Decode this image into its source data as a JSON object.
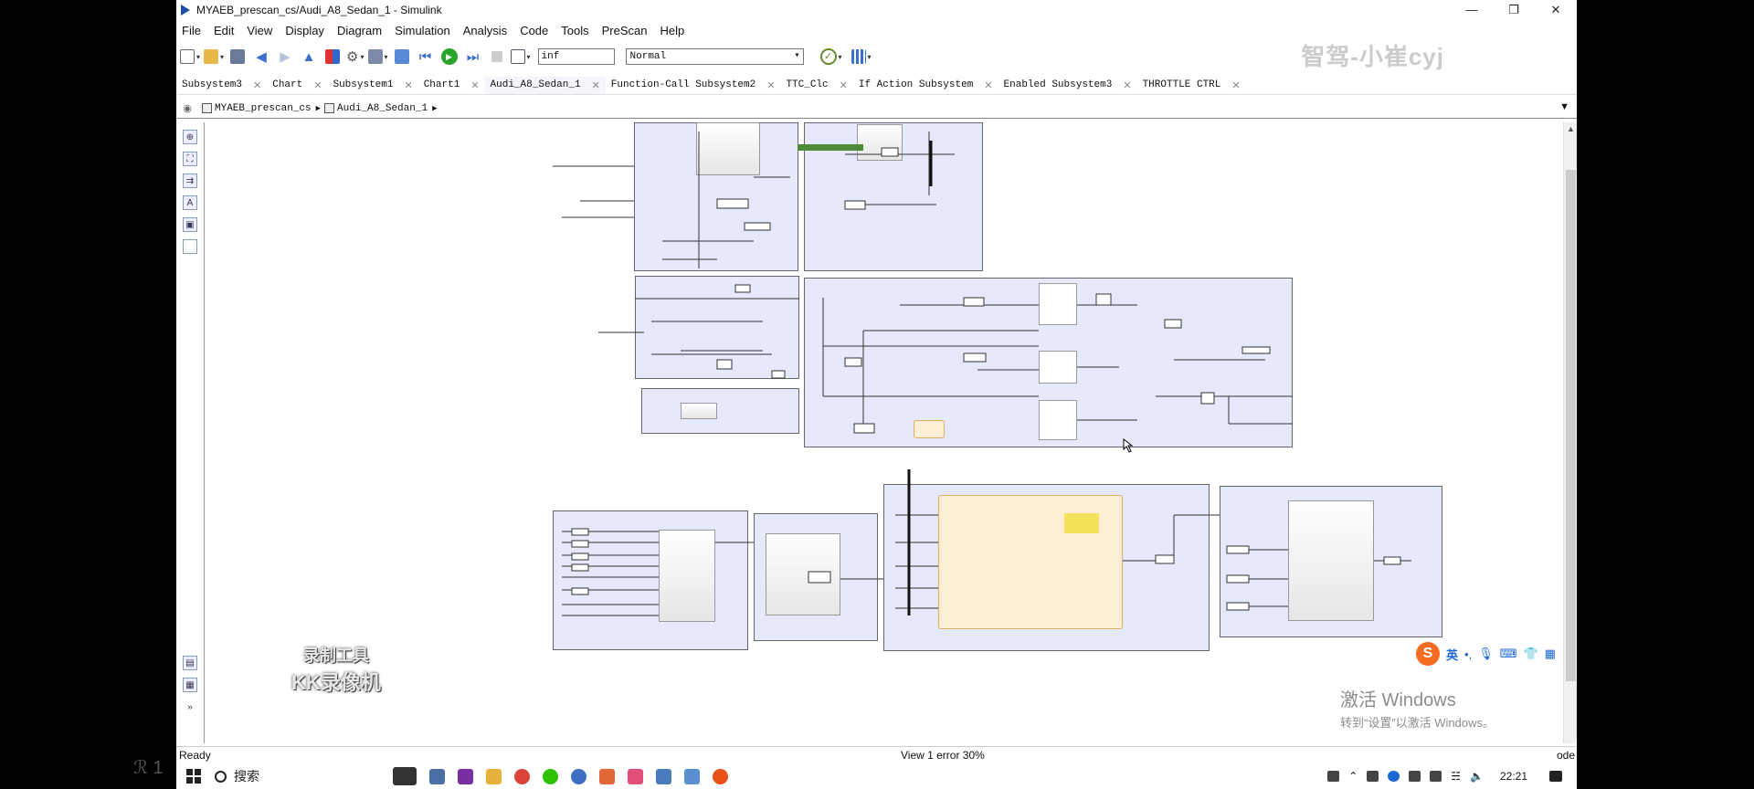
{
  "window": {
    "title": "MYAEB_prescan_cs/Audi_A8_Sedan_1 - Simulink",
    "controls": [
      "—",
      "❐",
      "✕"
    ]
  },
  "menu": [
    "File",
    "Edit",
    "View",
    "Display",
    "Diagram",
    "Simulation",
    "Analysis",
    "Code",
    "Tools",
    "PreScan",
    "Help"
  ],
  "toolbar": {
    "stop_time": "inf",
    "sim_mode": "Normal",
    "watermark": "智驾-小崔cyj"
  },
  "tabs": [
    {
      "label": "Subsystem3",
      "active": false
    },
    {
      "label": "Chart",
      "active": false
    },
    {
      "label": "Subsystem1",
      "active": false
    },
    {
      "label": "Chart1",
      "active": false
    },
    {
      "label": "Audi_A8_Sedan_1",
      "active": true
    },
    {
      "label": "Function-Call Subsystem2",
      "active": false
    },
    {
      "label": "TTC_Clc",
      "active": false
    },
    {
      "label": "If Action Subsystem",
      "active": false
    },
    {
      "label": "Enabled Subsystem3",
      "active": false
    },
    {
      "label": "THROTTLE CTRL",
      "active": false
    }
  ],
  "breadcrumb": [
    "MYAEB_prescan_cs",
    "Audi_A8_Sedan_1"
  ],
  "overlay": {
    "recorder_line1": "录制工具",
    "recorder_line2": "KK录像机"
  },
  "ime": {
    "lang": "英",
    "punct": "•,"
  },
  "activate": {
    "line1": "激活 Windows",
    "line2": "转到“设置”以激活 Windows。"
  },
  "status": {
    "left": "Ready",
    "middle": "View 1 error 30%",
    "right": "ode"
  },
  "taskbar": {
    "search": "搜索",
    "time": "22:21"
  },
  "left_overlay": "ℛ 1",
  "colors": {
    "subsystem_fill": "#e6e8fb",
    "chart_fill": "#fcefd6",
    "run_green": "#2aa52a"
  }
}
